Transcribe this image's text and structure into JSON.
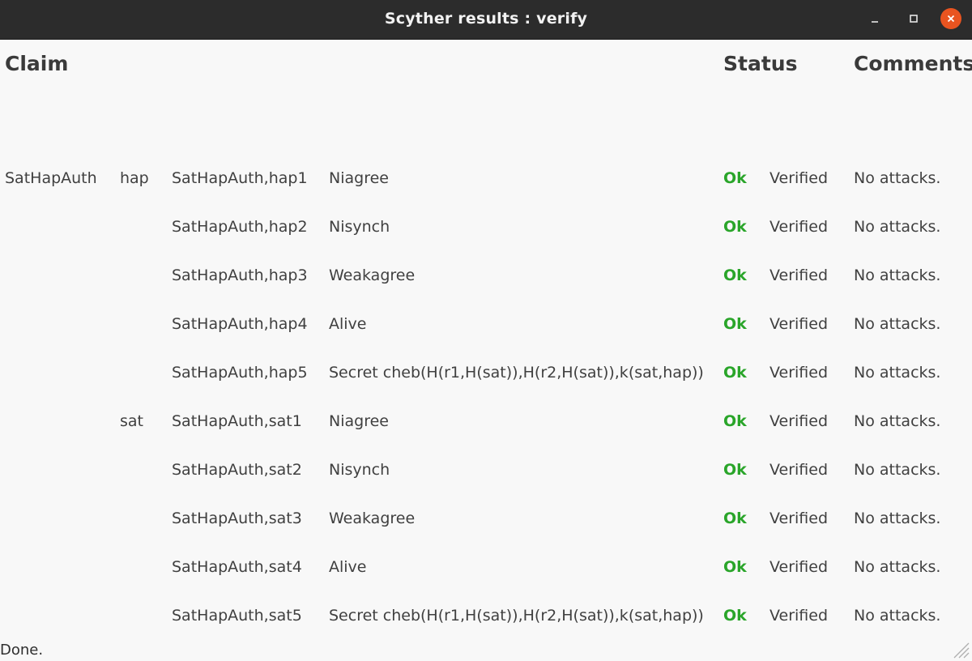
{
  "window": {
    "title": "Scyther results : verify"
  },
  "table": {
    "headers": {
      "claim": "Claim",
      "status": "Status",
      "comments": "Comments"
    },
    "rows": [
      {
        "protocol": "SatHapAuth",
        "role": "hap",
        "claim_id": "SatHapAuth,hap1",
        "claim": "Niagree",
        "result": "Ok",
        "status": "Verified",
        "comment": "No attacks."
      },
      {
        "protocol": "",
        "role": "",
        "claim_id": "SatHapAuth,hap2",
        "claim": "Nisynch",
        "result": "Ok",
        "status": "Verified",
        "comment": "No attacks."
      },
      {
        "protocol": "",
        "role": "",
        "claim_id": "SatHapAuth,hap3",
        "claim": "Weakagree",
        "result": "Ok",
        "status": "Verified",
        "comment": "No attacks."
      },
      {
        "protocol": "",
        "role": "",
        "claim_id": "SatHapAuth,hap4",
        "claim": "Alive",
        "result": "Ok",
        "status": "Verified",
        "comment": "No attacks."
      },
      {
        "protocol": "",
        "role": "",
        "claim_id": "SatHapAuth,hap5",
        "claim": "Secret cheb(H(r1,H(sat)),H(r2,H(sat)),k(sat,hap))",
        "result": "Ok",
        "status": "Verified",
        "comment": "No attacks."
      },
      {
        "protocol": "",
        "role": "sat",
        "claim_id": "SatHapAuth,sat1",
        "claim": "Niagree",
        "result": "Ok",
        "status": "Verified",
        "comment": "No attacks."
      },
      {
        "protocol": "",
        "role": "",
        "claim_id": "SatHapAuth,sat2",
        "claim": "Nisynch",
        "result": "Ok",
        "status": "Verified",
        "comment": "No attacks."
      },
      {
        "protocol": "",
        "role": "",
        "claim_id": "SatHapAuth,sat3",
        "claim": "Weakagree",
        "result": "Ok",
        "status": "Verified",
        "comment": "No attacks."
      },
      {
        "protocol": "",
        "role": "",
        "claim_id": "SatHapAuth,sat4",
        "claim": "Alive",
        "result": "Ok",
        "status": "Verified",
        "comment": "No attacks."
      },
      {
        "protocol": "",
        "role": "",
        "claim_id": "SatHapAuth,sat5",
        "claim": "Secret cheb(H(r1,H(sat)),H(r2,H(sat)),k(sat,hap))",
        "result": "Ok",
        "status": "Verified",
        "comment": "No attacks."
      }
    ]
  },
  "statusbar": {
    "text": "Done."
  },
  "icons": {
    "minimize": "minimize-icon",
    "maximize": "maximize-icon",
    "close": "close-icon",
    "resize": "resize-grip-icon"
  },
  "colors": {
    "ok": "#2aa52a",
    "close_button": "#e95420",
    "titlebar": "#2c2c2c"
  }
}
